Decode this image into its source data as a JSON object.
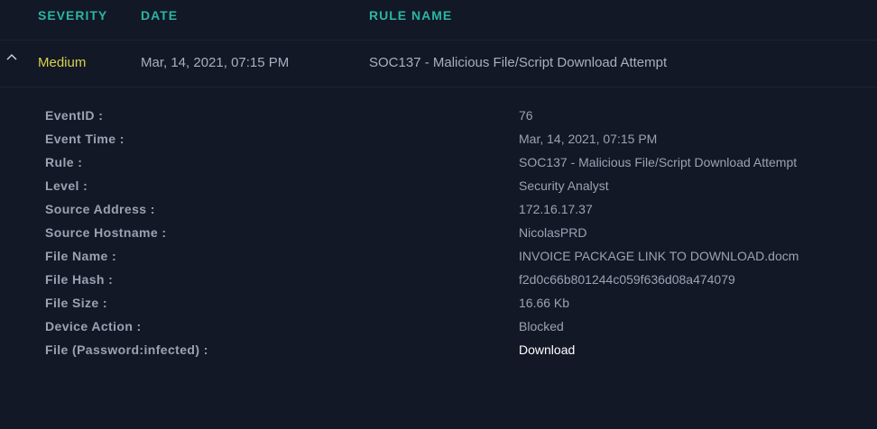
{
  "header": {
    "severity": "SEVERITY",
    "date": "DATE",
    "rule_name": "RULE NAME"
  },
  "alert": {
    "severity": "Medium",
    "date": "Mar, 14, 2021, 07:15 PM",
    "rule_name": "SOC137 - Malicious File/Script Download Attempt",
    "expand_icon": "chevron-up-icon"
  },
  "details": [
    {
      "label": "EventID :",
      "value": "76"
    },
    {
      "label": "Event Time :",
      "value": "Mar, 14, 2021, 07:15 PM"
    },
    {
      "label": "Rule :",
      "value": "SOC137 - Malicious File/Script Download Attempt"
    },
    {
      "label": "Level :",
      "value": "Security Analyst"
    },
    {
      "label": "Source Address :",
      "value": "172.16.17.37"
    },
    {
      "label": "Source Hostname :",
      "value": "NicolasPRD"
    },
    {
      "label": "File Name :",
      "value": "INVOICE PACKAGE LINK TO DOWNLOAD.docm"
    },
    {
      "label": "File Hash :",
      "value": "f2d0c66b801244c059f636d08a474079"
    },
    {
      "label": "File Size :",
      "value": "16.66 Kb"
    },
    {
      "label": "Device Action :",
      "value": "Blocked"
    },
    {
      "label": "File (Password:infected) :",
      "value": "Download"
    }
  ],
  "colors": {
    "background": "#121826",
    "header_accent": "#2bb5a3",
    "severity_medium": "#d8d24a",
    "text_muted": "#9aa3b3",
    "link": "#ffffff"
  }
}
